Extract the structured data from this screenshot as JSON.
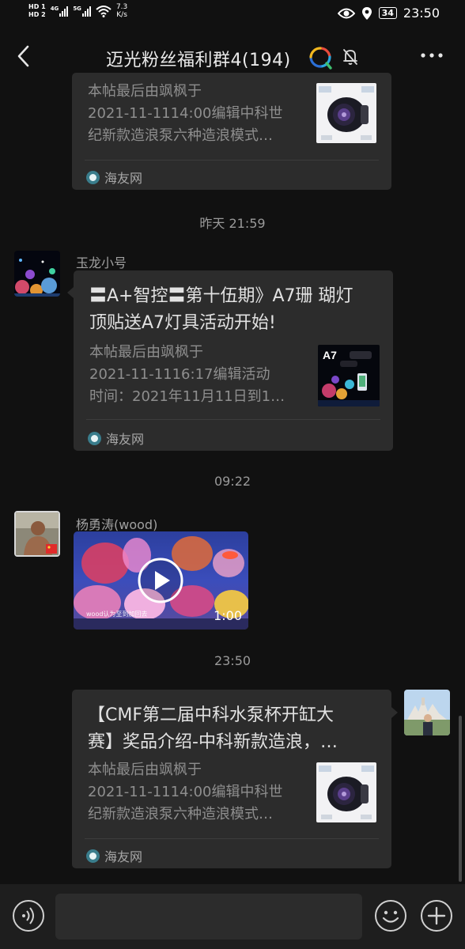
{
  "status_bar": {
    "sim1": "HD 1",
    "sim2": "HD 2",
    "net1": "4G",
    "net2": "5G",
    "speed_value": "7.3",
    "speed_unit": "K/s",
    "battery": "34",
    "time": "23:50"
  },
  "header": {
    "title": "迈光粉丝福利群4(194)",
    "icons": [
      "back-icon",
      "qq-icon",
      "mute-icon",
      "more-icon"
    ]
  },
  "messages": [
    {
      "type": "link_card",
      "title_lines": [],
      "desc_lines": [
        "本帖最后由飒枫于",
        "2021-11-1114:00编辑中科世",
        "纪新款造浪泵六种造浪模式…"
      ],
      "source": "海友网"
    },
    {
      "type": "timestamp",
      "text": "昨天 21:59"
    },
    {
      "type": "link_card",
      "sender": "玉龙小号",
      "title_lines": [
        "〓A+智控〓第十伍期》A7珊 瑚灯",
        "顶贴送A7灯具活动开始!"
      ],
      "desc_lines": [
        "本帖最后由飒枫于",
        "2021-11-1116:17编辑活动",
        "时间：2021年11月11日到1…"
      ],
      "thumb_label": "A7",
      "source": "海友网"
    },
    {
      "type": "timestamp",
      "text": "09:22"
    },
    {
      "type": "video",
      "sender": "杨勇涛(wood)",
      "duration": "1:00",
      "caption": "wood认为至到加回去"
    },
    {
      "type": "timestamp",
      "text": "23:50"
    },
    {
      "type": "link_card",
      "outgoing": true,
      "title_lines": [
        "【CMF第二届中科水泵杯开缸大",
        "赛】奖品介绍-中科新款造浪，…"
      ],
      "desc_lines": [
        "本帖最后由飒枫于",
        "2021-11-1114:00编辑中科世",
        "纪新款造浪泵六种造浪模式…"
      ],
      "source": "海友网"
    }
  ],
  "input_bar": {
    "placeholder": "",
    "icons": [
      "voice-icon",
      "emoji-icon",
      "plus-icon"
    ]
  }
}
